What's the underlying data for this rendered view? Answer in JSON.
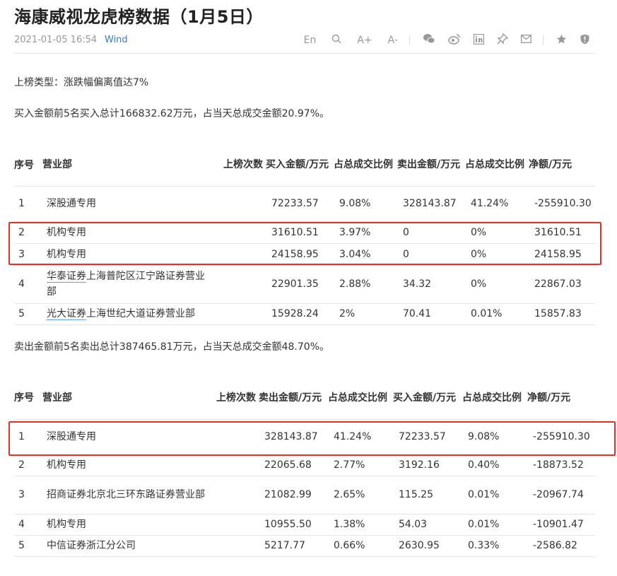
{
  "article": {
    "title": "海康威视龙虎榜数据（1月5日）",
    "date": "2021-01-05 16:54",
    "source": "Wind",
    "list_type": "上榜类型：涨跌幅偏离值达7%",
    "buy_summary": "买入金额前5名买入总计166832.62万元，占当天总成交金额20.97%。",
    "sell_summary": "卖出金额前5名卖出总计387465.81万元，占当天总成交金额48.70%。"
  },
  "toolbar": {
    "lang": "En",
    "font_up": "A+",
    "font_down": "A-"
  },
  "buy_table": {
    "headers": [
      "序号",
      "营业部",
      "上榜次数",
      "买入金额/万元",
      "占总成交比例",
      "卖出金额/万元",
      "占总成交比例",
      "净额/万元"
    ],
    "rows": [
      {
        "idx": "1",
        "dept_prefix": "",
        "dept": "深股通专用",
        "times": "",
        "buy": "72233.57",
        "buy_pct": "9.08%",
        "sell": "328143.87",
        "sell_pct": "41.24%",
        "net": "-255910.30"
      },
      {
        "idx": "2",
        "dept_prefix": "",
        "dept": "机构专用",
        "times": "",
        "buy": "31610.51",
        "buy_pct": "3.97%",
        "sell": "0",
        "sell_pct": "0%",
        "net": "31610.51"
      },
      {
        "idx": "3",
        "dept_prefix": "",
        "dept": "机构专用",
        "times": "",
        "buy": "24158.95",
        "buy_pct": "3.04%",
        "sell": "0",
        "sell_pct": "0%",
        "net": "24158.95"
      },
      {
        "idx": "4",
        "dept_prefix": "华泰证券",
        "dept": "上海普陀区江宁路证券营业部",
        "times": "",
        "buy": "22901.35",
        "buy_pct": "2.88%",
        "sell": "34.32",
        "sell_pct": "0%",
        "net": "22867.03"
      },
      {
        "idx": "5",
        "dept_prefix": "光大证券",
        "dept": "上海世纪大道证券营业部",
        "times": "",
        "buy": "15928.24",
        "buy_pct": "2%",
        "sell": "70.41",
        "sell_pct": "0.01%",
        "net": "15857.83"
      }
    ]
  },
  "sell_table": {
    "headers": [
      "序号",
      "营业部",
      "上榜次数",
      "卖出金额/万元",
      "占总成交比例",
      "买入金额/万元",
      "占总成交比例",
      "净额/万元"
    ],
    "rows": [
      {
        "idx": "1",
        "dept": "深股通专用",
        "times": "",
        "sell": "328143.87",
        "sell_pct": "41.24%",
        "buy": "72233.57",
        "buy_pct": "9.08%",
        "net": "-255910.30"
      },
      {
        "idx": "2",
        "dept": "机构专用",
        "times": "",
        "sell": "22065.68",
        "sell_pct": "2.77%",
        "buy": "3192.16",
        "buy_pct": "0.40%",
        "net": "-18873.52"
      },
      {
        "idx": "3",
        "dept": "招商证券北京北三环东路证券营业部",
        "times": "",
        "sell": "21082.99",
        "sell_pct": "2.65%",
        "buy": "115.25",
        "buy_pct": "0.01%",
        "net": "-20967.74"
      },
      {
        "idx": "4",
        "dept": "机构专用",
        "times": "",
        "sell": "10955.50",
        "sell_pct": "1.38%",
        "buy": "54.03",
        "buy_pct": "0.01%",
        "net": "-10901.47"
      },
      {
        "idx": "5",
        "dept": "中信证券浙江分公司",
        "times": "",
        "sell": "5217.77",
        "sell_pct": "0.66%",
        "buy": "2630.95",
        "buy_pct": "0.33%",
        "net": "-2586.82"
      }
    ]
  },
  "colors": {
    "accent": "#3b7bbf",
    "highlight": "#e0322b"
  }
}
